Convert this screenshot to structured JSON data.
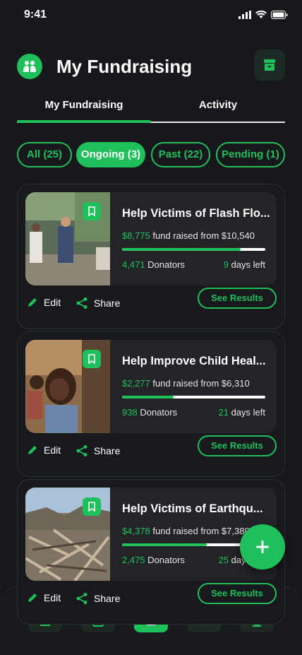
{
  "status_bar": {
    "time": "9:41"
  },
  "header": {
    "title": "My Fundraising"
  },
  "tabs": [
    {
      "label": "My Fundraising",
      "active": true
    },
    {
      "label": "Activity",
      "active": false
    }
  ],
  "filters": [
    {
      "label": "All (25)",
      "active": false
    },
    {
      "label": "Ongoing (3)",
      "active": true
    },
    {
      "label": "Past (22)",
      "active": false
    },
    {
      "label": "Pending (1)",
      "active": false
    }
  ],
  "campaigns": [
    {
      "title": "Help Victims of Flash Flo...",
      "raised_amount": "$8,775",
      "raised_text": "fund raised from $10,540",
      "progress": 0.83,
      "donators_count": "4,471",
      "donators_label": "Donators",
      "days_count": "9",
      "days_label": "days left",
      "edit_label": "Edit",
      "share_label": "Share",
      "results_label": "See Results"
    },
    {
      "title": "Help Improve Child Heal...",
      "raised_amount": "$2,277",
      "raised_text": "fund raised from $6,310",
      "progress": 0.36,
      "donators_count": "938",
      "donators_label": "Donators",
      "days_count": "21",
      "days_label": "days left",
      "edit_label": "Edit",
      "share_label": "Share",
      "results_label": "See Results"
    },
    {
      "title": "Help Victims of Earthqu...",
      "raised_amount": "$4,378",
      "raised_text": "fund raised from $7,380",
      "progress": 0.59,
      "donators_count": "2,475",
      "donators_label": "Donators",
      "days_count": "25",
      "days_label": "days left",
      "edit_label": "Edit",
      "share_label": "Share",
      "results_label": "See Results"
    }
  ],
  "bottom_nav": [
    {
      "icon": "home-icon",
      "active": false
    },
    {
      "icon": "list-icon",
      "active": false
    },
    {
      "icon": "fundraising-icon",
      "active": true
    },
    {
      "icon": "chat-icon",
      "active": false
    },
    {
      "icon": "profile-icon",
      "active": false
    }
  ],
  "colors": {
    "accent": "#1fbf5c",
    "background": "#17181b",
    "card": "#222427"
  }
}
